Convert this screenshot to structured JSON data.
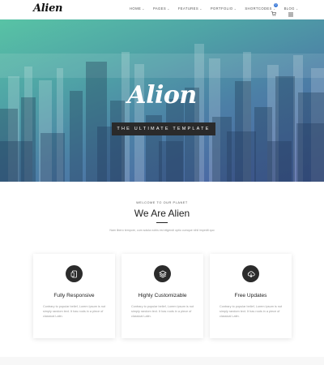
{
  "header": {
    "logo": "Alien",
    "nav": [
      {
        "label": "HOME"
      },
      {
        "label": "PAGES"
      },
      {
        "label": "FEATURES"
      },
      {
        "label": "PORTFOLIO"
      },
      {
        "label": "SHORTCODES"
      },
      {
        "label": "BLOG"
      }
    ],
    "cart_count": "0",
    "cart_icon": "cart-icon",
    "menu_icon": "hamburger-icon"
  },
  "hero": {
    "title": "Alion",
    "tagline": "THE ULTIMATE TEMPLATE"
  },
  "welcome": {
    "kicker": "WELCOME TO OUR PLANET",
    "title": "We Are Alien",
    "description": "Nam libero tempore, cum soluta nobis est eligendi optio cumque nihil impedit quo"
  },
  "features": [
    {
      "icon": "mobile-icon",
      "title": "Fully Responsive",
      "text": "Contrary to popular belief, Lorem Ipsum is not simply random text. It has roots in a piece of classical Latin."
    },
    {
      "icon": "layers-icon",
      "title": "Highly Customizable",
      "text": "Contrary to popular belief, Lorem Ipsum is not simply random text. It has roots in a piece of classical Latin."
    },
    {
      "icon": "cloud-download-icon",
      "title": "Free Updates",
      "text": "Contrary to popular belief, Lorem Ipsum is not simply random text. It has roots in a piece of classical Latin."
    }
  ],
  "colors": {
    "hero_gradient_start": "#58c3a5",
    "hero_gradient_end": "#4a5da2",
    "accent": "#3a79d8",
    "dark": "#2b2b2b"
  }
}
